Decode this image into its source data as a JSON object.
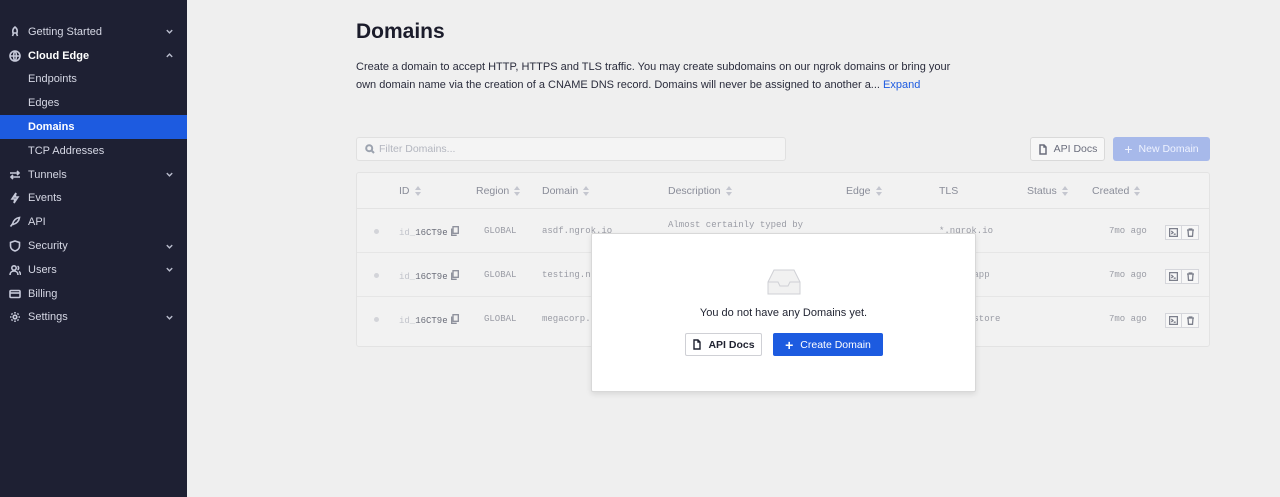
{
  "sidebar": {
    "items": [
      {
        "label": "Getting Started",
        "icon": "rocket-icon",
        "chevron": "down"
      },
      {
        "label": "Cloud Edge",
        "icon": "globe-icon",
        "chevron": "up"
      },
      {
        "label": "Endpoints",
        "sub": true
      },
      {
        "label": "Edges",
        "sub": true
      },
      {
        "label": "Domains",
        "sub": true,
        "active": true
      },
      {
        "label": "TCP Addresses",
        "sub": true
      },
      {
        "label": "Tunnels",
        "icon": "tunnel-arrows-icon",
        "chevron": "down"
      },
      {
        "label": "Events",
        "icon": "lightning-icon"
      },
      {
        "label": "API",
        "icon": "rocket-api-icon"
      },
      {
        "label": "Security",
        "icon": "shield-icon",
        "chevron": "down"
      },
      {
        "label": "Users",
        "icon": "users-icon",
        "chevron": "down"
      },
      {
        "label": "Billing",
        "icon": "credit-card-icon"
      },
      {
        "label": "Settings",
        "icon": "gear-icon",
        "chevron": "down"
      }
    ]
  },
  "page": {
    "title": "Domains",
    "description": "Create a domain to accept HTTP, HTTPS and TLS traffic. You may create subdomains on our ngrok domains or bring your own domain name via the creation of a CNAME DNS record. Domains will never be assigned to another a...",
    "expand_label": "Expand"
  },
  "toolbar": {
    "filter_placeholder": "Filter Domains...",
    "api_docs_label": "API Docs",
    "new_domain_label": "New Domain"
  },
  "table": {
    "columns": [
      "ID",
      "Region",
      "Domain",
      "Description",
      "Edge",
      "TLS",
      "Status",
      "Created"
    ],
    "rows": [
      {
        "id_prefix": "id_",
        "id": "16CT9e",
        "region": "GLOBAL",
        "domain": "asdf.ngrok.io",
        "description_1": "Almost certainly typed by",
        "description_2": "",
        "tls": "*.ngrok.io",
        "created": "7mo ago"
      },
      {
        "id_prefix": "id_",
        "id": "16CT9e",
        "region": "GLOBAL",
        "domain": "testing.n",
        "description_1": "",
        "description_2": "",
        "tls": ".app",
        "created": "7mo ago"
      },
      {
        "id_prefix": "id_",
        "id": "16CT9e",
        "region": "GLOBAL",
        "domain": "megacorp.",
        "description_1": "",
        "description_2": "",
        "tls": ".store",
        "created": "7mo ago"
      }
    ]
  },
  "modal": {
    "empty_text": "You do not have any Domains yet.",
    "api_docs_label": "API Docs",
    "create_label": "Create Domain"
  },
  "colors": {
    "sidebar_bg": "#1e2033",
    "accent": "#1d5be0",
    "page_bg": "#efefef"
  }
}
